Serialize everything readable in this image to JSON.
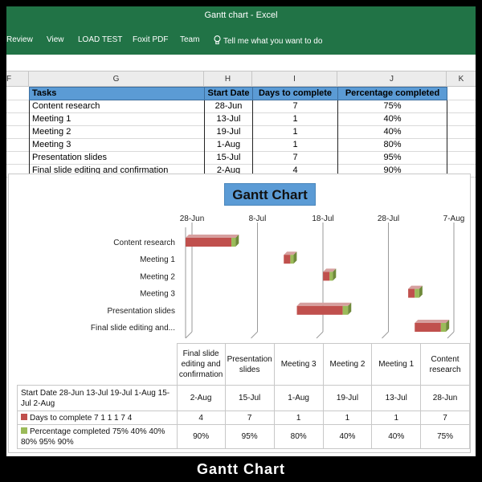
{
  "window_title": "Gantt chart - Excel",
  "ribbon_tabs": [
    "Review",
    "View",
    "LOAD TEST",
    "Foxit PDF",
    "Team"
  ],
  "tell_me": "Tell me what you want to do",
  "column_headers": [
    "F",
    "G",
    "H",
    "I",
    "J",
    "K"
  ],
  "table": {
    "headers": [
      "Tasks",
      "Start Date",
      "Days to complete",
      "Percentage completed"
    ],
    "rows": [
      [
        "Content research",
        "28-Jun",
        "7",
        "75%"
      ],
      [
        "Meeting 1",
        "13-Jul",
        "1",
        "40%"
      ],
      [
        "Meeting 2",
        "19-Jul",
        "1",
        "40%"
      ],
      [
        "Meeting 3",
        "1-Aug",
        "1",
        "80%"
      ],
      [
        "Presentation slides",
        "15-Jul",
        "7",
        "95%"
      ],
      [
        "Final slide editing and confirmation",
        "2-Aug",
        "4",
        "90%"
      ]
    ]
  },
  "chart_data": {
    "type": "bar",
    "title": "Gantt Chart",
    "x_tick_labels": [
      "28-Jun",
      "8-Jul",
      "18-Jul",
      "28-Jul",
      "7-Aug"
    ],
    "x_ticks_days": [
      0,
      10,
      20,
      30,
      40
    ],
    "categories": [
      "Content research",
      "Meeting 1",
      "Meeting 2",
      "Meeting 3",
      "Presentation slides",
      "Final slide editing and..."
    ],
    "start_day": [
      0,
      15,
      21,
      34,
      17,
      35
    ],
    "series": [
      {
        "name": "Days to complete 7 1 1 1 7 4",
        "values": [
          7,
          1,
          1,
          1,
          7,
          4
        ],
        "color": "#c0504d"
      },
      {
        "name": "Percentage completed 75% 40% 40% 80% 95% 90%",
        "values": [
          0.75,
          0.4,
          0.4,
          0.8,
          0.95,
          0.9
        ],
        "color": "#9bbb59"
      }
    ]
  },
  "data_table": {
    "columns": [
      "Final slide editing and confirmation",
      "Presentation slides",
      "Meeting 3",
      "Meeting 2",
      "Meeting 1",
      "Content research"
    ],
    "rows": [
      {
        "label": "Start Date  28-Jun 13-Jul 19-Jul 1-Aug 15-Jul 2-Aug",
        "key": "",
        "values": [
          "2-Aug",
          "15-Jul",
          "1-Aug",
          "19-Jul",
          "13-Jul",
          "28-Jun"
        ]
      },
      {
        "label": "Days to complete 7 1 1 1 7 4",
        "key": "#c0504d",
        "values": [
          "4",
          "7",
          "1",
          "1",
          "1",
          "7"
        ]
      },
      {
        "label": "Percentage completed 75% 40% 40% 80% 95% 90%",
        "key": "#9bbb59",
        "values": [
          "90%",
          "95%",
          "80%",
          "40%",
          "40%",
          "75%"
        ]
      }
    ]
  },
  "caption": "Gantt Chart"
}
